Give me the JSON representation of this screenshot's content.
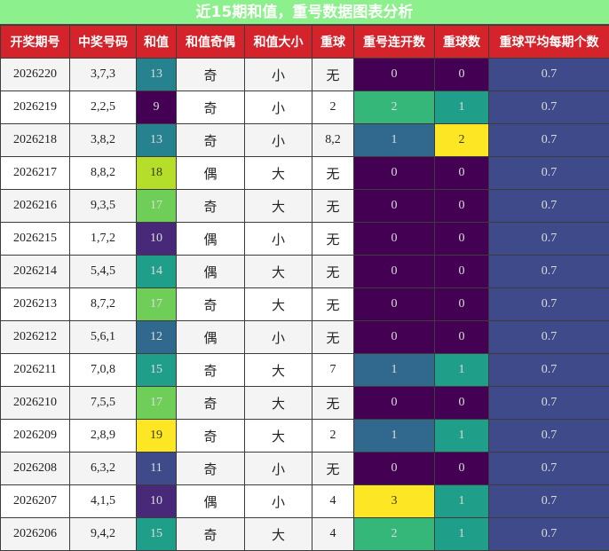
{
  "title": "近15期和值，重号数据图表分析",
  "colors": {
    "title_bg": "#8cf08c",
    "header_bg": "#d4232a",
    "viridis": [
      "#440154",
      "#482878",
      "#3e4a89",
      "#31688e",
      "#26828e",
      "#1f9e89",
      "#35b779",
      "#6ece58",
      "#b5de2b",
      "#fde725"
    ]
  },
  "headers": [
    "开奖期号",
    "中奖号码",
    "和值",
    "和值奇偶",
    "和值大小",
    "重球",
    "重号连开数",
    "重球数",
    "重球平均每期个数"
  ],
  "chart_data": {
    "type": "table",
    "title": "近15期和值，重号数据图表分析",
    "columns": [
      "开奖期号",
      "中奖号码",
      "和值",
      "和值奇偶",
      "和值大小",
      "重球",
      "重号连开数",
      "重球数",
      "重球平均每期个数"
    ],
    "rows": [
      [
        "2026220",
        "3,7,3",
        "13",
        "奇",
        "小",
        "无",
        "0",
        "0",
        "0.7"
      ],
      [
        "2026219",
        "2,2,5",
        "9",
        "奇",
        "小",
        "2",
        "2",
        "1",
        "0.7"
      ],
      [
        "2026218",
        "3,8,2",
        "13",
        "奇",
        "小",
        "8,2",
        "1",
        "2",
        "0.7"
      ],
      [
        "2026217",
        "8,8,2",
        "18",
        "偶",
        "大",
        "无",
        "0",
        "0",
        "0.7"
      ],
      [
        "2026216",
        "9,3,5",
        "17",
        "奇",
        "大",
        "无",
        "0",
        "0",
        "0.7"
      ],
      [
        "2026215",
        "1,7,2",
        "10",
        "偶",
        "小",
        "无",
        "0",
        "0",
        "0.7"
      ],
      [
        "2026214",
        "5,4,5",
        "14",
        "偶",
        "大",
        "无",
        "0",
        "0",
        "0.7"
      ],
      [
        "2026213",
        "8,7,2",
        "17",
        "奇",
        "大",
        "无",
        "0",
        "0",
        "0.7"
      ],
      [
        "2026212",
        "5,6,1",
        "12",
        "偶",
        "小",
        "无",
        "0",
        "0",
        "0.7"
      ],
      [
        "2026211",
        "7,0,8",
        "15",
        "奇",
        "大",
        "7",
        "1",
        "1",
        "0.7"
      ],
      [
        "2026210",
        "7,5,5",
        "17",
        "奇",
        "大",
        "无",
        "0",
        "0",
        "0.7"
      ],
      [
        "2026209",
        "2,8,9",
        "19",
        "奇",
        "大",
        "2",
        "1",
        "1",
        "0.7"
      ],
      [
        "2026208",
        "6,3,2",
        "11",
        "奇",
        "小",
        "无",
        "0",
        "0",
        "0.7"
      ],
      [
        "2026207",
        "4,1,5",
        "10",
        "偶",
        "小",
        "4",
        "3",
        "1",
        "0.7"
      ],
      [
        "2026206",
        "9,4,2",
        "15",
        "奇",
        "大",
        "4",
        "2",
        "1",
        "0.7"
      ]
    ],
    "heatmap_columns": {
      "和值": {
        "range": [
          9,
          19
        ]
      },
      "重号连开数": {
        "range": [
          0,
          3
        ]
      },
      "重球数": {
        "range": [
          0,
          2
        ]
      },
      "重球平均每期个数": {
        "range": [
          0,
          3
        ]
      }
    }
  }
}
